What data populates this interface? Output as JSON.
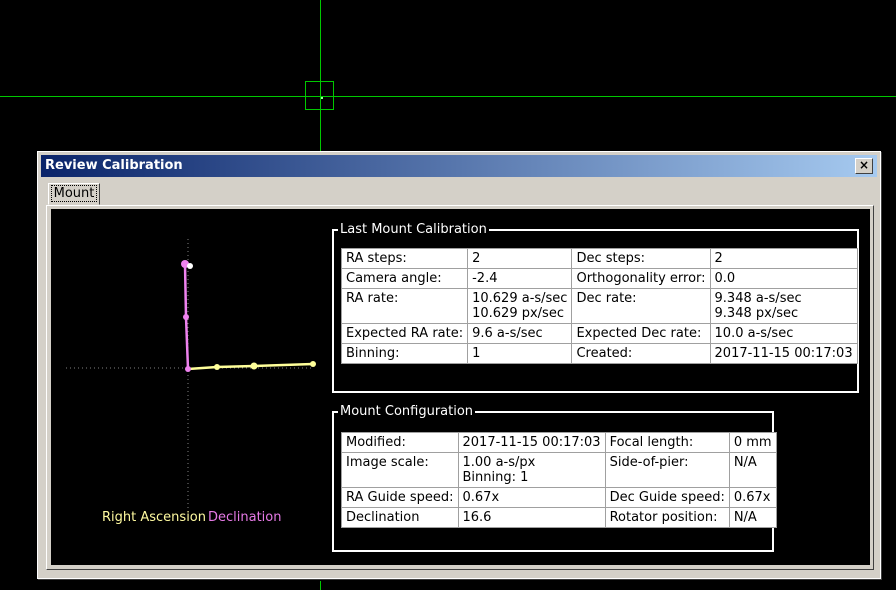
{
  "window": {
    "title": "Review Calibration",
    "close_label": "×"
  },
  "tabs": [
    {
      "label": "Mount"
    }
  ],
  "legend": {
    "ra": "Right Ascension",
    "dec": "Declination"
  },
  "colors": {
    "ra": "#ffff9a",
    "dec": "#ee82ee",
    "crosshair": "#00c800"
  },
  "last_calibration": {
    "title": "Last Mount Calibration",
    "rows": [
      [
        "RA steps:",
        "2",
        "Dec steps:",
        "2"
      ],
      [
        "Camera angle:",
        "-2.4",
        "Orthogonality error:",
        "0.0"
      ],
      [
        "RA rate:",
        "10.629 a-s/sec\n10.629 px/sec",
        "Dec rate:",
        "9.348 a-s/sec\n9.348 px/sec"
      ],
      [
        "Expected RA rate:",
        "9.6 a-s/sec",
        "Expected Dec rate:",
        "10.0 a-s/sec"
      ],
      [
        "Binning:",
        "1",
        "Created:",
        "2017-11-15 00:17:03"
      ]
    ]
  },
  "mount_config": {
    "title": "Mount Configuration",
    "rows": [
      [
        "Modified:",
        "2017-11-15 00:17:03",
        "Focal length:",
        "0 mm"
      ],
      [
        "Image scale:",
        "1.00 a-s/px\nBinning: 1",
        "Side-of-pier:",
        "N/A"
      ],
      [
        "RA Guide speed:",
        "0.67x",
        "Dec Guide speed:",
        "0.67x"
      ],
      [
        "Declination",
        "16.6",
        "Rotator position:",
        "N/A"
      ]
    ]
  }
}
